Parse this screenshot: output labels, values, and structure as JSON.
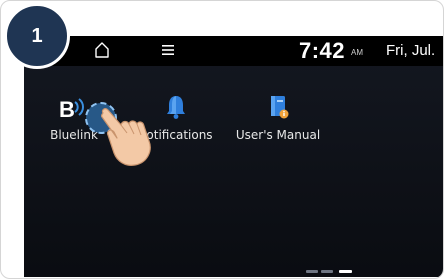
{
  "step": {
    "number": "1"
  },
  "status_bar": {
    "home_icon": "home-icon",
    "menu_icon": "menu-icon",
    "time": "7:42",
    "ampm": "AM",
    "date": "Fri, Jul."
  },
  "apps": [
    {
      "label": "Bluelink",
      "icon": "bluelink-icon"
    },
    {
      "label": "Notifications",
      "icon": "bell-icon"
    },
    {
      "label": "User's Manual",
      "icon": "manual-book-icon"
    }
  ],
  "page_indicator": {
    "pages": 3,
    "current": 3
  },
  "colors": {
    "screen_bg": "#0f1219",
    "status_bar_bg": "#000000",
    "accent_blue": "#3a8fe0",
    "badge_bg": "#1f3553",
    "hand_skin": "#f3c9a6"
  }
}
